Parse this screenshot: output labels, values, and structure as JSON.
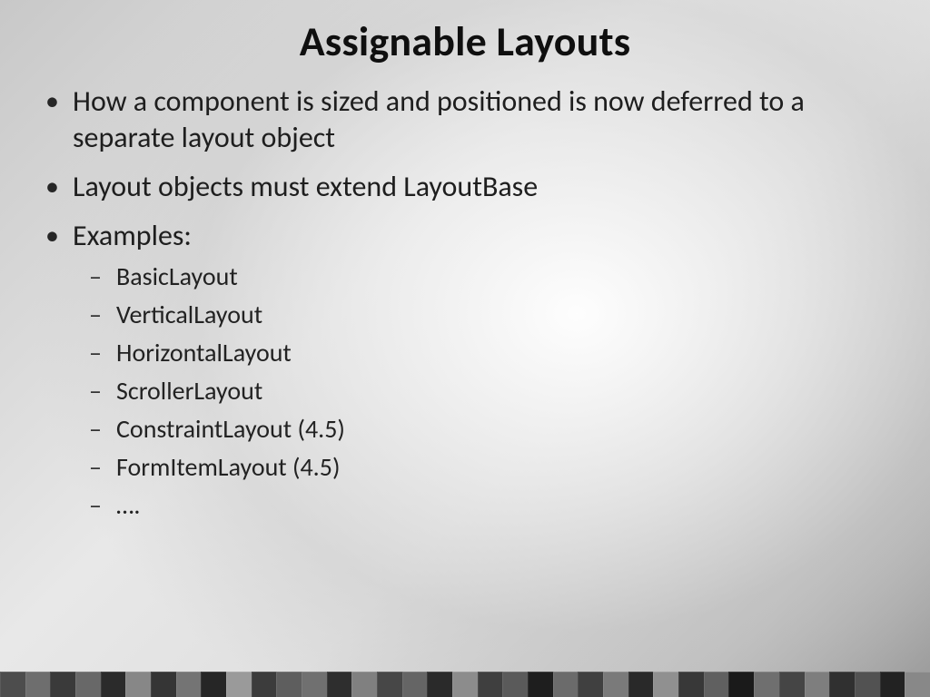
{
  "title": "Assignable Layouts",
  "bullets": {
    "b1": "How a component is sized and positioned is now deferred to a separate layout object",
    "b2": "Layout objects must extend LayoutBase",
    "b3": "Examples:"
  },
  "examples": {
    "e1": "BasicLayout",
    "e2": "VerticalLayout",
    "e3": "HorizontalLayout",
    "e4": "ScrollerLayout",
    "e5": "ConstraintLayout (4.5)",
    "e6": "FormItemLayout (4.5)",
    "e7": "…."
  },
  "strip_colors": [
    "#4d4d4d",
    "#6e6e6e",
    "#3a3a3a",
    "#686868",
    "#2b2b2b",
    "#878787",
    "#353535",
    "#747474",
    "#262626",
    "#9a9a9a",
    "#3c3c3c",
    "#5e5e5e",
    "#707070",
    "#2e2e2e",
    "#808080",
    "#474747",
    "#656565",
    "#2a2a2a",
    "#8c8c8c",
    "#3f3f3f",
    "#5a5a5a",
    "#1e1e1e",
    "#6b6b6b",
    "#404040",
    "#7a7a7a",
    "#292929",
    "#909090",
    "#383838",
    "#606060",
    "#1a1a1a",
    "#6f6f6f",
    "#454545",
    "#7e7e7e",
    "#303030",
    "#525252",
    "#222222",
    "#888888"
  ]
}
